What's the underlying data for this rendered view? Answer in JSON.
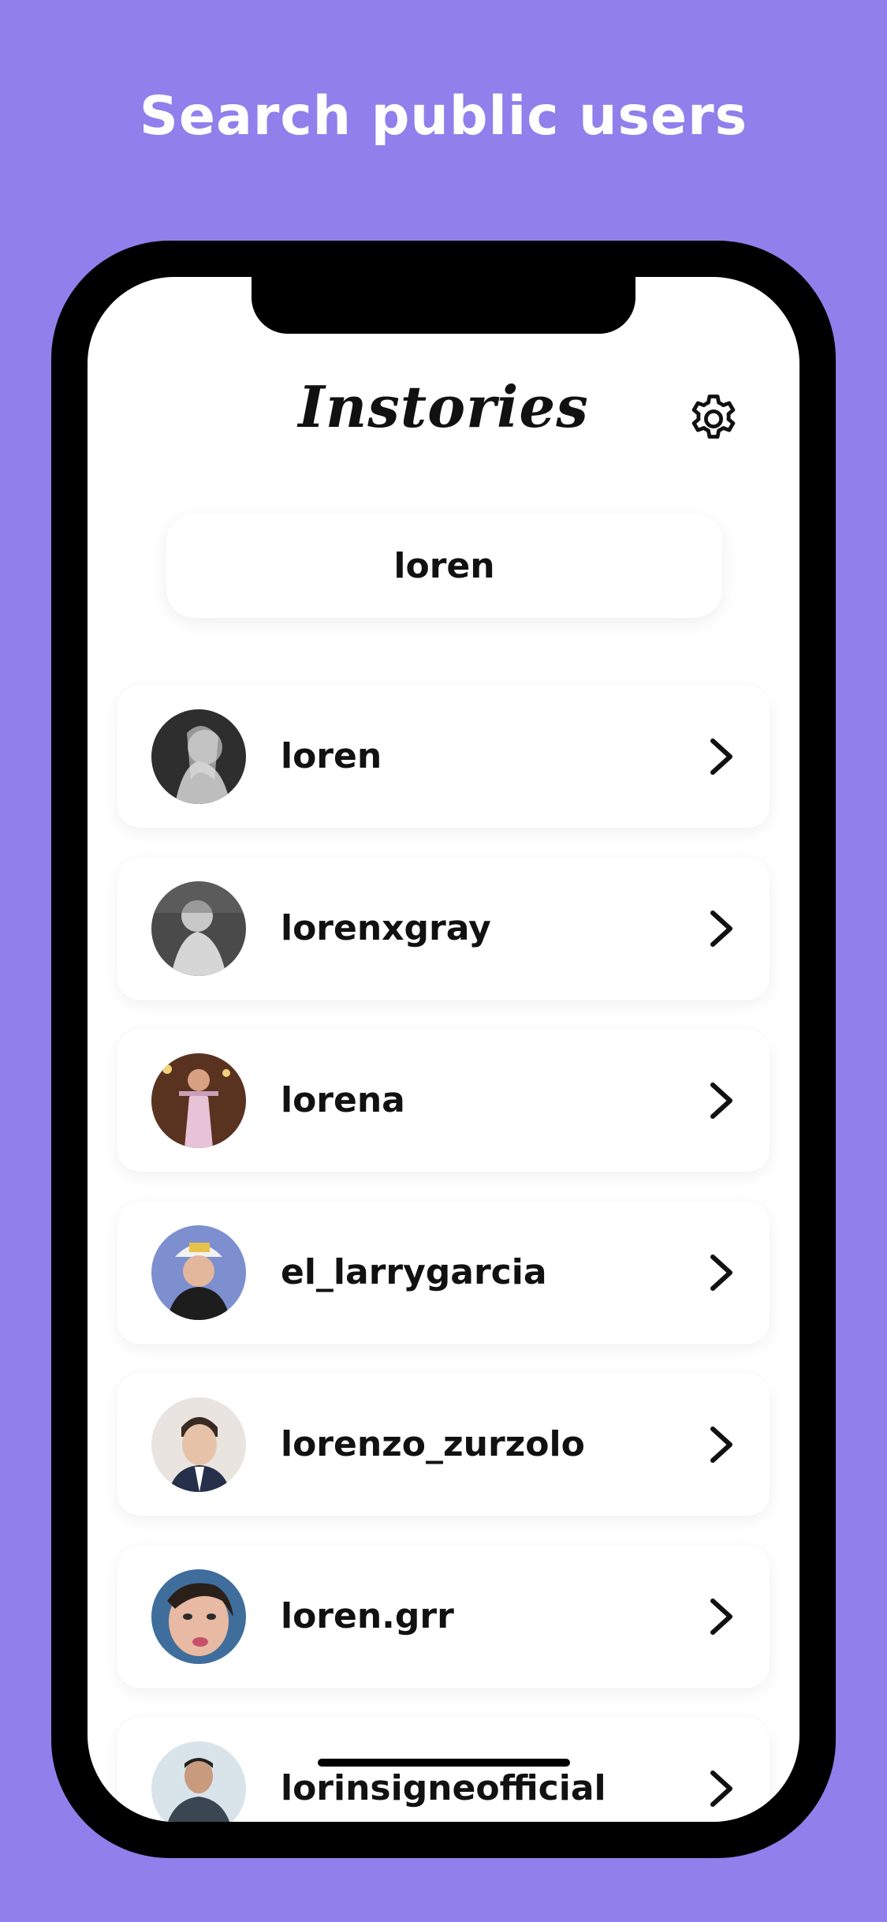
{
  "headline": "Search public users",
  "app": {
    "logo": "Instories",
    "settings_icon": "gear-icon"
  },
  "search": {
    "value": "loren",
    "placeholder": ""
  },
  "results": [
    {
      "username": "loren",
      "avatar_color": "#3a3a3a"
    },
    {
      "username": "lorenxgray",
      "avatar_color": "#555555"
    },
    {
      "username": "lorena",
      "avatar_color": "#7a4a35"
    },
    {
      "username": "el_larrygarcia",
      "avatar_color": "#6b7fc4"
    },
    {
      "username": "lorenzo_zurzolo",
      "avatar_color": "#c9b9a8"
    },
    {
      "username": "loren.grr",
      "avatar_color": "#3f6e9c"
    },
    {
      "username": "lorinsigneofficial",
      "avatar_color": "#8aa4b8"
    }
  ],
  "colors": {
    "background": "#917fec",
    "text": "#111111"
  }
}
